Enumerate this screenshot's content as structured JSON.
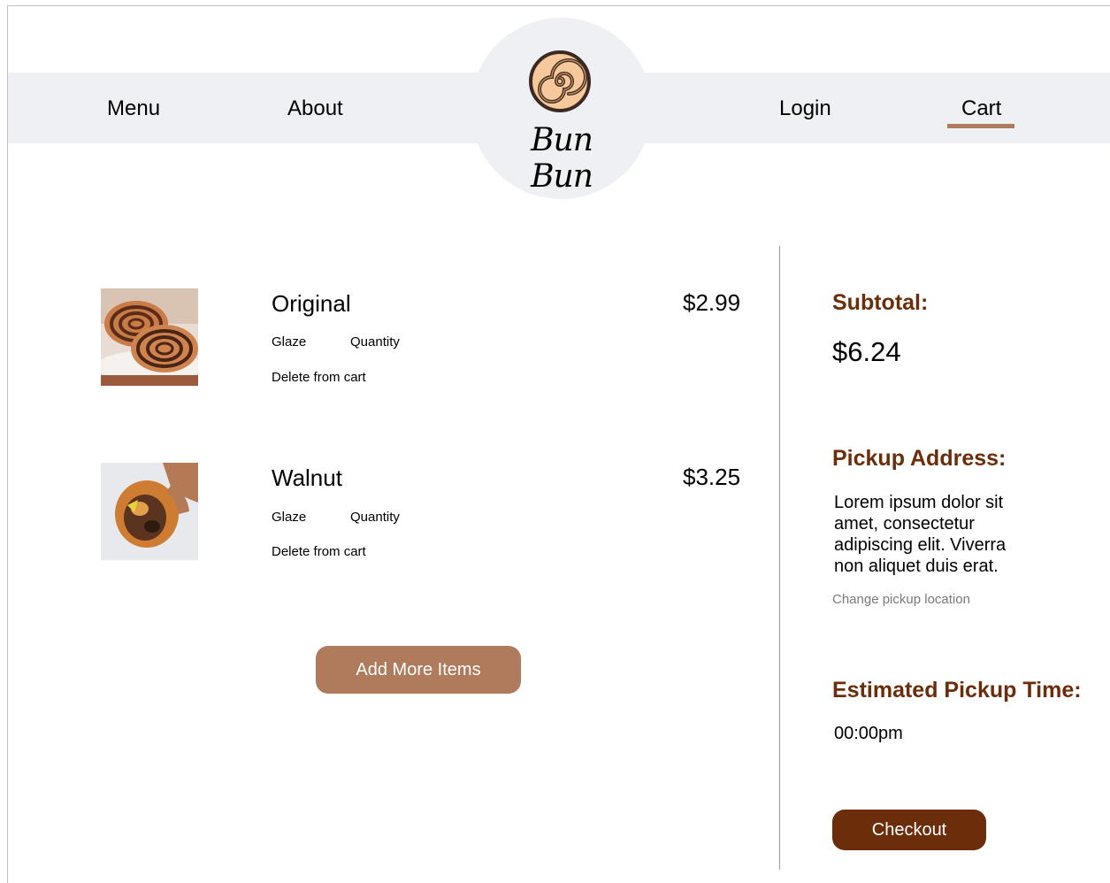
{
  "nav": {
    "menu": "Menu",
    "about": "About",
    "login": "Login",
    "cart": "Cart"
  },
  "logo": {
    "text": "Bun Bun",
    "icon": "cinnamon-roll-icon"
  },
  "cart_items": [
    {
      "name": "Original",
      "price": "$2.99",
      "glaze_label": "Glaze",
      "quantity_label": "Quantity",
      "delete_label": "Delete from cart",
      "image": "original-cinnamon-roll"
    },
    {
      "name": "Walnut",
      "price": "$3.25",
      "glaze_label": "Glaze",
      "quantity_label": "Quantity",
      "delete_label": "Delete from cart",
      "image": "walnut-cinnamon-roll"
    }
  ],
  "add_more_label": "Add More Items",
  "summary": {
    "subtotal_label": "Subtotal:",
    "subtotal_value": "$6.24",
    "pickup_label": "Pickup Address:",
    "pickup_address": "Lorem ipsum dolor sit amet, consectetur adipiscing elit. Viverra non aliquet duis erat.",
    "change_location": "Change pickup location",
    "time_label": "Estimated Pickup Time:",
    "time_value": "00:00pm",
    "checkout_label": "Checkout"
  },
  "colors": {
    "accent": "#b07a5d",
    "brand_dark": "#6b2d0a",
    "nav_bg": "#eff0f4"
  }
}
